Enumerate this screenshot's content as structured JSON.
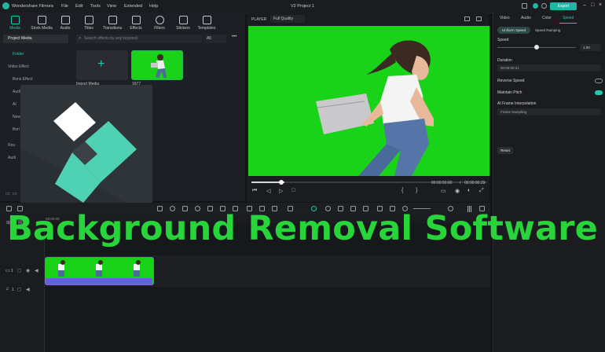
{
  "app": {
    "name": "Wondershare Filmora",
    "menu": [
      "File",
      "Edit",
      "Tools",
      "View",
      "Extended",
      "Help"
    ],
    "project_title": "V2 Project 1",
    "export_label": "Export"
  },
  "media_tabs": [
    {
      "label": "Media",
      "icon": "media-icon"
    },
    {
      "label": "Stock Media",
      "icon": "cloud-icon"
    },
    {
      "label": "Audio",
      "icon": "music-icon"
    },
    {
      "label": "Titles",
      "icon": "title-icon"
    },
    {
      "label": "Transitions",
      "icon": "transition-icon"
    },
    {
      "label": "Effects",
      "icon": "effects-icon"
    },
    {
      "label": "Filters",
      "icon": "filter-icon"
    },
    {
      "label": "Stickers",
      "icon": "sticker-icon"
    },
    {
      "label": "Templates",
      "icon": "template-icon"
    }
  ],
  "sidebar": {
    "items": [
      "Project Media",
      "Folder",
      "Video Effect",
      "Boris Effect",
      "Audi",
      "AI",
      "New",
      "Bori",
      "Rou",
      "Audi"
    ]
  },
  "search": {
    "placeholder": "Search effects by any keyword",
    "filter": "All"
  },
  "media": {
    "import_label": "Import Media",
    "clip_label": "1677"
  },
  "player": {
    "label": "PLAYER",
    "quality": "Full Quality",
    "time_current": "00:00:00:00",
    "time_total": "00:00:00:29"
  },
  "right_panel": {
    "tabs": [
      "Video",
      "Audio",
      "Color",
      "Speed"
    ],
    "subtabs": [
      "Uniform Speed",
      "Speed Ramping"
    ],
    "speed_label": "Speed",
    "speed_value": "1.00",
    "duration_label": "Duration",
    "duration_value": "00:00:00:21",
    "reverse_label": "Reverse Speed",
    "pitch_label": "Maintain Pitch",
    "interp_label": "AI Frame Interpolation",
    "interp_value": "Frame Sampling",
    "reset_label": "Reset"
  },
  "timeline": {
    "ruler_start": "00:00:00",
    "track_video": "1",
    "track_audio": "1"
  },
  "headline": "Background Removal Software",
  "colors": {
    "accent": "#1bb8a6",
    "chroma_green": "#19d319",
    "headline_green": "#27d43a",
    "clip_border": "#7a6cf0"
  }
}
